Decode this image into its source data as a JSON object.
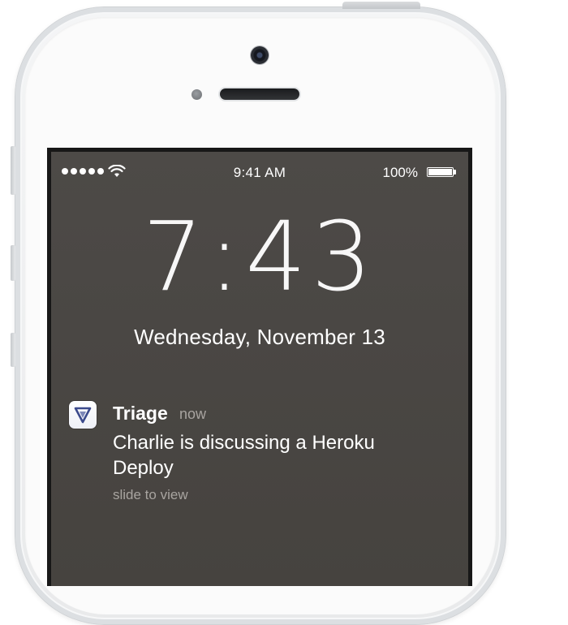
{
  "status_bar": {
    "signal_dots": 5,
    "time": "9:41 AM",
    "battery_percent": "100%"
  },
  "lock_screen": {
    "clock": "7:43",
    "date": "Wednesday, November 13"
  },
  "notification": {
    "app_name": "Triage",
    "time": "now",
    "message": "Charlie is discussing a Heroku Deploy",
    "hint": "slide to view",
    "icon": "triage-triangle-icon"
  },
  "colors": {
    "wallpaper": "#4b4845",
    "text": "#ffffff",
    "muted_text": "#a8a4a0",
    "icon_accent": "#3b4a8c"
  }
}
